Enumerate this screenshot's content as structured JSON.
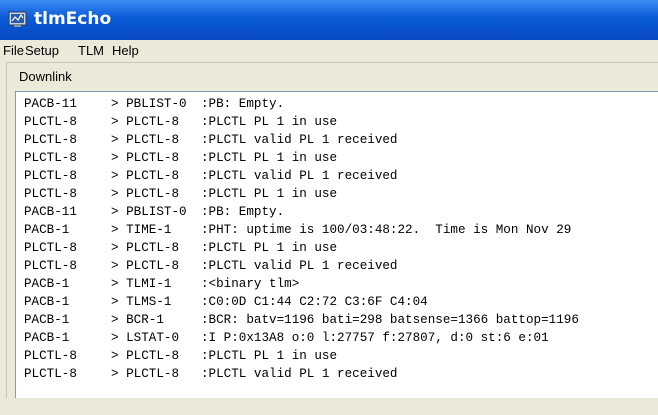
{
  "window": {
    "title": "tlmEcho",
    "icon": "tlmecho-app-icon"
  },
  "menu": [
    "File",
    "Setup",
    "TLM",
    "Help"
  ],
  "downlink": {
    "label": "Downlink",
    "rows": [
      [
        "PACB-11",
        "> PBLIST-0",
        ":PB: Empty."
      ],
      [
        "PLCTL-8",
        "> PLCTL-8",
        ":PLCTL PL 1 in use"
      ],
      [
        "PLCTL-8",
        "> PLCTL-8",
        ":PLCTL valid PL 1 received"
      ],
      [
        "PLCTL-8",
        "> PLCTL-8",
        ":PLCTL PL 1 in use"
      ],
      [
        "PLCTL-8",
        "> PLCTL-8",
        ":PLCTL valid PL 1 received"
      ],
      [
        "PLCTL-8",
        "> PLCTL-8",
        ":PLCTL PL 1 in use"
      ],
      [
        "PACB-11",
        "> PBLIST-0",
        ":PB: Empty."
      ],
      [
        "PACB-1",
        "> TIME-1",
        ":PHT: uptime is 100/03:48:22.  Time is Mon Nov 29"
      ],
      [
        "PLCTL-8",
        "> PLCTL-8",
        ":PLCTL PL 1 in use"
      ],
      [
        "PLCTL-8",
        "> PLCTL-8",
        ":PLCTL valid PL 1 received"
      ],
      [
        "PACB-1",
        "> TLMI-1",
        ":<binary tlm>"
      ],
      [
        "PACB-1",
        "> TLMS-1",
        ":C0:0D C1:44 C2:72 C3:6F C4:04"
      ],
      [
        "PACB-1",
        "> BCR-1",
        ":BCR: batv=1196 bati=298 batsense=1366 battop=1196"
      ],
      [
        "PACB-1",
        "> LSTAT-0",
        ":I P:0x13A8 o:0 l:27757 f:27807, d:0 st:6 e:01"
      ],
      [
        "PLCTL-8",
        "> PLCTL-8",
        ":PLCTL PL 1 in use"
      ],
      [
        "PLCTL-8",
        "> PLCTL-8",
        ":PLCTL valid PL 1 received"
      ]
    ]
  }
}
